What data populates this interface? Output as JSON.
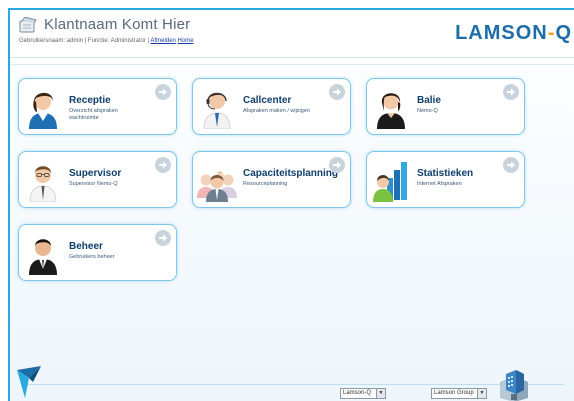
{
  "header": {
    "title": "Klantnaam Komt Hier",
    "user_prefix": "Gebruikersnaam: admin | Functie: Administrator |",
    "logout_label": "Afmelden",
    "home_label": "Home",
    "logo_main": "LAMSON",
    "logo_dash": "-",
    "logo_q": "Q",
    "logo_color": "#1d6da8",
    "accent": "#f0a01a"
  },
  "tiles": [
    {
      "title": "Receptie",
      "subtitle": "Overzicht afspraken wachtruimte",
      "icon": "woman-receptionist-icon"
    },
    {
      "title": "Callcenter",
      "subtitle": "Afspraken maken / wijzigen",
      "icon": "headset-agent-icon"
    },
    {
      "title": "Balie",
      "subtitle": "Nemo-Q",
      "icon": "woman-desk-icon"
    },
    {
      "title": "Supervisor",
      "subtitle": "Supervisor Nemo-Q",
      "icon": "supervisor-man-icon"
    },
    {
      "title": "Capaciteitsplanning",
      "subtitle": "Resourceplanning",
      "icon": "group-people-icon"
    },
    {
      "title": "Statistieken",
      "subtitle": "Internet Afspraken",
      "icon": "chart-person-icon"
    },
    {
      "title": "Beheer",
      "subtitle": "Gebruikers beheer",
      "icon": "admin-man-icon"
    }
  ],
  "footer": {
    "product_select": "Lamson-Q",
    "group_select": "Lamson Group"
  }
}
